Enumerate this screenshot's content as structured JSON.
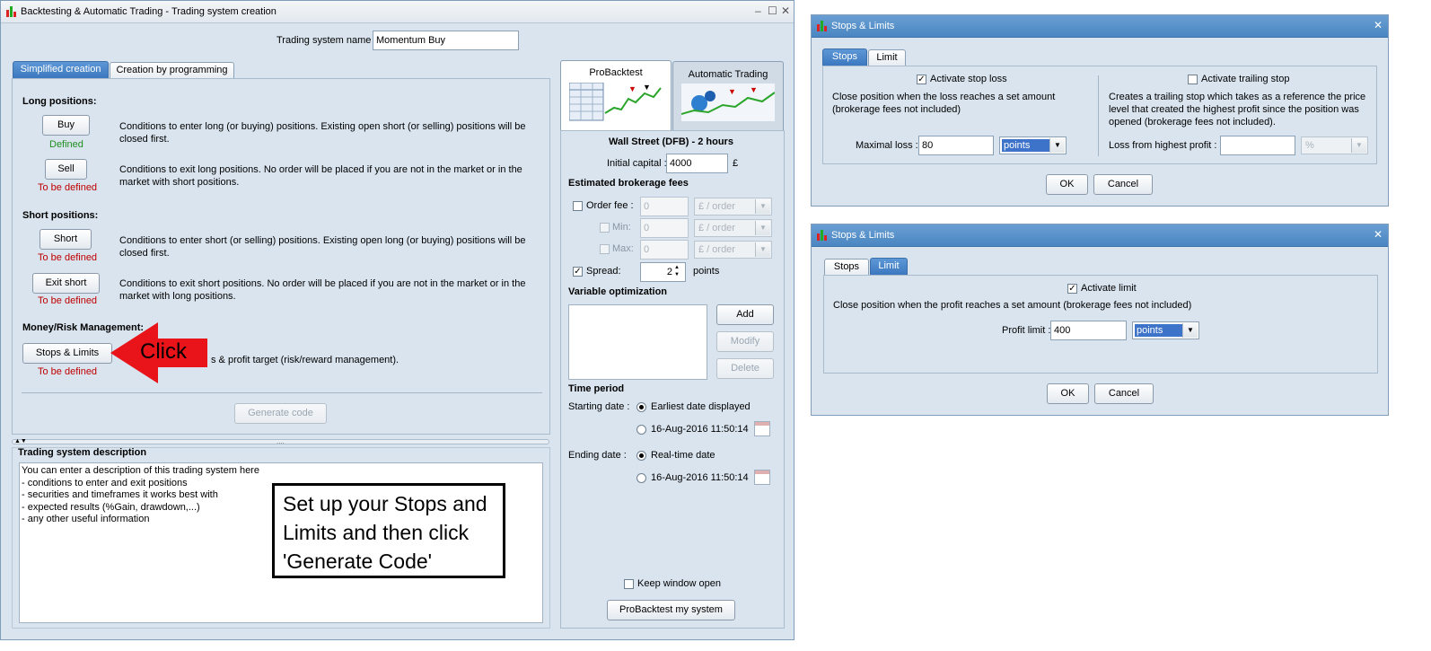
{
  "main_window": {
    "title": "Backtesting & Automatic Trading - Trading system creation",
    "system_name_label": "Trading system name",
    "system_name_value": "Momentum Buy",
    "tabs": [
      "Simplified creation",
      "Creation by programming"
    ],
    "long_positions_heading": "Long positions:",
    "short_positions_heading": "Short positions:",
    "money_heading": "Money/Risk Management:",
    "rows": [
      {
        "button": "Buy",
        "status": "Defined",
        "desc": "Conditions to enter long (or buying) positions. Existing open short (or selling) positions will be closed first."
      },
      {
        "button": "Sell",
        "status": "To be defined",
        "desc": "Conditions to exit long positions. No order will be placed if you are not in the market or in the market with short positions."
      },
      {
        "button": "Short",
        "status": "To be defined",
        "desc": "Conditions to enter short (or selling) positions. Existing open long (or buying) positions will be closed first."
      },
      {
        "button": "Exit short",
        "status": "To be defined",
        "desc": "Conditions to exit short positions. No order will be placed if you are not in the market or in the market with long positions."
      }
    ],
    "stops_button": "Stops & Limits",
    "stops_status": "To be defined",
    "stops_desc_visible": "s & profit target (risk/reward management).",
    "generate_code": "Generate code",
    "description_heading": "Trading system description",
    "description_lines": [
      "You can enter a description of this trading system here",
      "- conditions to enter and exit positions",
      "- securities and timeframes it works best with",
      "- expected results (%Gain, drawdown,...)",
      "- any other useful information"
    ],
    "right_tabs": [
      "ProBacktest",
      "Automatic Trading"
    ],
    "instrument": "Wall Street (DFB) - 2 hours",
    "initial_capital_label": "Initial capital :",
    "initial_capital_value": "4000",
    "currency": "£",
    "brokerage_heading": "Estimated brokerage fees",
    "order_fee_label": "Order fee :",
    "min_label": "Min:",
    "max_label": "Max:",
    "fee_value": "0",
    "fee_unit": "£ / order",
    "spread_label": "Spread:",
    "spread_value": "2",
    "spread_unit": "points",
    "variable_heading": "Variable optimization",
    "add": "Add",
    "modify": "Modify",
    "delete": "Delete",
    "time_heading": "Time period",
    "starting_label": "Starting date :",
    "earliest": "Earliest date displayed",
    "date_value": "16-Aug-2016 11:50:14",
    "ending_label": "Ending date :",
    "realtime": "Real-time date",
    "keep_open": "Keep window open",
    "probacktest_button": "ProBacktest my system"
  },
  "annotations": {
    "click_label": "Click",
    "callout_text": "Set up your Stops and Limits and then click 'Generate Code'"
  },
  "dialog_stops": {
    "title": "Stops & Limits",
    "tabs": [
      "Stops",
      "Limit"
    ],
    "activate_stop": "Activate stop loss",
    "stop_desc": "Close position when the loss reaches a set amount (brokerage fees not included)",
    "maximal_loss_label": "Maximal loss :",
    "maximal_loss_value": "80",
    "unit": "points",
    "activate_trailing": "Activate trailing stop",
    "trailing_desc": "Creates a trailing stop which takes as a reference the price level that created the highest profit since the position was opened (brokerage fees not included).",
    "loss_highest_label": "Loss from highest profit :",
    "percent_unit": "%",
    "ok": "OK",
    "cancel": "Cancel"
  },
  "dialog_limit": {
    "title": "Stops & Limits",
    "tabs": [
      "Stops",
      "Limit"
    ],
    "activate_limit": "Activate limit",
    "limit_desc": "Close position when the profit reaches a set amount (brokerage fees not included)",
    "profit_limit_label": "Profit limit :",
    "profit_limit_value": "400",
    "unit": "points",
    "ok": "OK",
    "cancel": "Cancel"
  },
  "colors": {
    "accent": "#3c78bf",
    "defined": "#1f8f1f",
    "undefined": "#c00000",
    "arrow": "#e8141a"
  }
}
